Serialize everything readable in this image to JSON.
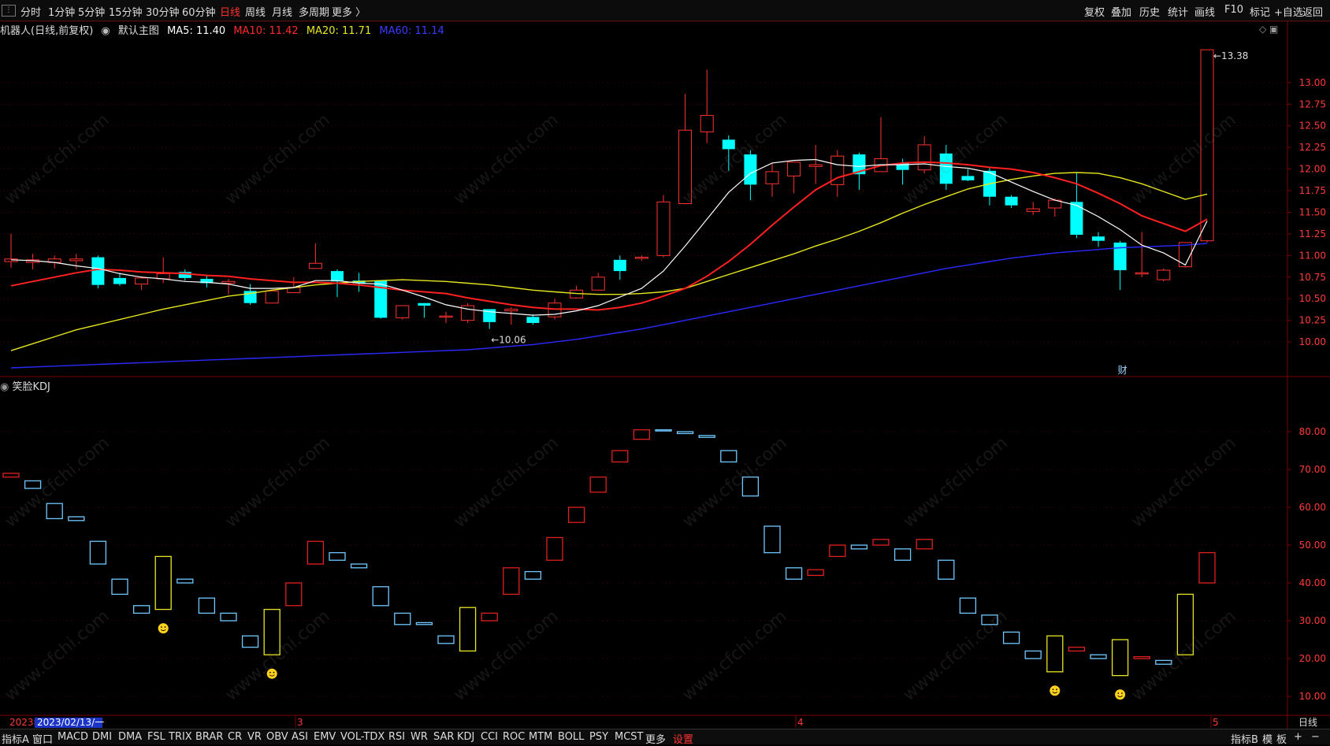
{
  "toolbar": {
    "left": [
      "分时",
      "1分钟",
      "5分钟",
      "15分钟",
      "30分钟",
      "60分钟",
      "日线",
      "周线",
      "月线",
      "多周期",
      "更多 〉"
    ],
    "active": "日线",
    "right": [
      "复权",
      "叠加",
      "历史",
      "统计",
      "画线",
      "F10",
      "标记",
      "+自选",
      "返回"
    ]
  },
  "main_info": {
    "name": "机器人(日线,前复权)",
    "chart_name": "默认主图",
    "ma5": "MA5: 11.40",
    "ma10": "MA10: 11.42",
    "ma20": "MA20: 11.71",
    "ma60": "MA60: 11.14"
  },
  "kdj_info": {
    "name": "笑脸KDJ"
  },
  "colors": {
    "up": "#ff3232",
    "down": "#00ffff",
    "ma5": "#ffffff",
    "ma10": "#ff2020",
    "ma20": "#e6e61e",
    "ma60": "#2a2aff",
    "kdj_up": "#e02020",
    "kdj_down": "#6fc8ff",
    "kdj_flag": "#e6e620",
    "grid": "#7a0000"
  },
  "annotations": {
    "low_label": "10.06",
    "high_label": "13.38",
    "fin_mark": "财"
  },
  "x_axis": {
    "date_box": "2023/02/13/一",
    "year_tag": "2023年",
    "month_marks": [
      "3",
      "4",
      "5"
    ],
    "period": "日线"
  },
  "bottom_tabs": [
    "指标A",
    "窗口",
    "MACD",
    "DMI",
    "DMA",
    "FSL",
    "TRIX",
    "BRAR",
    "CR",
    "VR",
    "OBV",
    "ASI",
    "EMV",
    "VOL-TDX",
    "RSI",
    "WR",
    "SAR",
    "KDJ",
    "CCI",
    "ROC",
    "MTM",
    "BOLL",
    "PSY",
    "MCST",
    "更多",
    "设置"
  ],
  "bottom_right": [
    "指标B",
    "模",
    "板",
    "+",
    "−"
  ],
  "watermark": "www.cfchi.com",
  "chart_data": [
    {
      "type": "candlestick",
      "title": "机器人(日线,前复权)",
      "ylim": [
        9.6,
        13.5
      ],
      "y_ticks": [
        10.0,
        10.25,
        10.5,
        10.75,
        11.0,
        11.25,
        11.5,
        11.75,
        12.0,
        12.25,
        12.5,
        12.75,
        13.0
      ],
      "candles": [
        {
          "o": 10.93,
          "h": 11.25,
          "l": 10.86,
          "c": 10.96
        },
        {
          "o": 10.92,
          "h": 11.02,
          "l": 10.84,
          "c": 10.95
        },
        {
          "o": 10.92,
          "h": 11.0,
          "l": 10.85,
          "c": 10.96
        },
        {
          "o": 10.94,
          "h": 11.02,
          "l": 10.84,
          "c": 10.96
        },
        {
          "o": 10.98,
          "h": 11.0,
          "l": 10.62,
          "c": 10.66
        },
        {
          "o": 10.74,
          "h": 10.8,
          "l": 10.65,
          "c": 10.67
        },
        {
          "o": 10.67,
          "h": 10.76,
          "l": 10.6,
          "c": 10.74
        },
        {
          "o": 10.73,
          "h": 10.98,
          "l": 10.68,
          "c": 10.79
        },
        {
          "o": 10.81,
          "h": 10.84,
          "l": 10.71,
          "c": 10.74
        },
        {
          "o": 10.73,
          "h": 10.78,
          "l": 10.63,
          "c": 10.68
        },
        {
          "o": 10.68,
          "h": 10.73,
          "l": 10.55,
          "c": 10.7
        },
        {
          "o": 10.59,
          "h": 10.67,
          "l": 10.43,
          "c": 10.45
        },
        {
          "o": 10.45,
          "h": 10.6,
          "l": 10.45,
          "c": 10.59
        },
        {
          "o": 10.57,
          "h": 10.75,
          "l": 10.57,
          "c": 10.63
        },
        {
          "o": 10.85,
          "h": 11.14,
          "l": 10.85,
          "c": 10.91
        },
        {
          "o": 10.82,
          "h": 10.84,
          "l": 10.52,
          "c": 10.7
        },
        {
          "o": 10.71,
          "h": 10.8,
          "l": 10.58,
          "c": 10.68
        },
        {
          "o": 10.71,
          "h": 10.71,
          "l": 10.27,
          "c": 10.28
        },
        {
          "o": 10.28,
          "h": 10.42,
          "l": 10.26,
          "c": 10.42
        },
        {
          "o": 10.45,
          "h": 10.45,
          "l": 10.28,
          "c": 10.42
        },
        {
          "o": 10.3,
          "h": 10.35,
          "l": 10.22,
          "c": 10.3
        },
        {
          "o": 10.25,
          "h": 10.45,
          "l": 10.22,
          "c": 10.42
        },
        {
          "o": 10.38,
          "h": 10.38,
          "l": 10.15,
          "c": 10.23
        },
        {
          "o": 10.36,
          "h": 10.4,
          "l": 10.2,
          "c": 10.38
        },
        {
          "o": 10.29,
          "h": 10.32,
          "l": 10.2,
          "c": 10.22
        },
        {
          "o": 10.29,
          "h": 10.5,
          "l": 10.26,
          "c": 10.45
        },
        {
          "o": 10.51,
          "h": 10.65,
          "l": 10.5,
          "c": 10.6
        },
        {
          "o": 10.6,
          "h": 10.8,
          "l": 10.6,
          "c": 10.75
        },
        {
          "o": 10.95,
          "h": 11.0,
          "l": 10.72,
          "c": 10.82
        },
        {
          "o": 10.97,
          "h": 11.0,
          "l": 10.94,
          "c": 10.98
        },
        {
          "o": 11.0,
          "h": 11.7,
          "l": 10.98,
          "c": 11.62
        },
        {
          "o": 11.6,
          "h": 12.87,
          "l": 11.62,
          "c": 12.45
        },
        {
          "o": 12.43,
          "h": 13.15,
          "l": 12.3,
          "c": 12.62
        },
        {
          "o": 12.34,
          "h": 12.39,
          "l": 11.98,
          "c": 12.23
        },
        {
          "o": 12.17,
          "h": 12.22,
          "l": 11.64,
          "c": 11.82
        },
        {
          "o": 11.83,
          "h": 12.07,
          "l": 11.68,
          "c": 11.97
        },
        {
          "o": 11.92,
          "h": 12.07,
          "l": 11.72,
          "c": 12.08
        },
        {
          "o": 12.03,
          "h": 12.28,
          "l": 11.83,
          "c": 12.05
        },
        {
          "o": 11.82,
          "h": 12.22,
          "l": 11.68,
          "c": 12.15
        },
        {
          "o": 12.17,
          "h": 12.19,
          "l": 11.76,
          "c": 11.94
        },
        {
          "o": 11.97,
          "h": 12.6,
          "l": 11.97,
          "c": 12.12
        },
        {
          "o": 12.07,
          "h": 12.12,
          "l": 11.82,
          "c": 11.99
        },
        {
          "o": 11.99,
          "h": 12.38,
          "l": 11.95,
          "c": 12.28
        },
        {
          "o": 12.18,
          "h": 12.28,
          "l": 11.76,
          "c": 11.83
        },
        {
          "o": 11.92,
          "h": 12.0,
          "l": 11.86,
          "c": 11.87
        },
        {
          "o": 11.98,
          "h": 12.02,
          "l": 11.58,
          "c": 11.68
        },
        {
          "o": 11.68,
          "h": 11.7,
          "l": 11.55,
          "c": 11.58
        },
        {
          "o": 11.51,
          "h": 11.62,
          "l": 11.47,
          "c": 11.54
        },
        {
          "o": 11.55,
          "h": 11.66,
          "l": 11.45,
          "c": 11.64
        },
        {
          "o": 11.62,
          "h": 11.95,
          "l": 11.2,
          "c": 11.24
        },
        {
          "o": 11.22,
          "h": 11.27,
          "l": 11.1,
          "c": 11.17
        },
        {
          "o": 11.15,
          "h": 11.17,
          "l": 10.6,
          "c": 10.83
        },
        {
          "o": 10.8,
          "h": 11.27,
          "l": 10.75,
          "c": 10.8
        },
        {
          "o": 10.72,
          "h": 10.85,
          "l": 10.7,
          "c": 10.83
        },
        {
          "o": 10.87,
          "h": 11.15,
          "l": 10.86,
          "c": 11.15
        },
        {
          "o": 11.17,
          "h": 13.38,
          "l": 11.15,
          "c": 13.38
        }
      ],
      "ma5": [
        10.95,
        10.94,
        10.92,
        10.88,
        10.85,
        10.79,
        10.75,
        10.73,
        10.7,
        10.69,
        10.67,
        10.62,
        10.62,
        10.63,
        10.71,
        10.71,
        10.68,
        10.67,
        10.6,
        10.52,
        10.43,
        10.38,
        10.35,
        10.33,
        10.31,
        10.32,
        10.36,
        10.42,
        10.52,
        10.62,
        10.82,
        11.11,
        11.42,
        11.73,
        11.95,
        12.07,
        12.1,
        12.11,
        12.05,
        12.03,
        12.05,
        12.05,
        12.06,
        12.03,
        12.01,
        11.96,
        11.85,
        11.74,
        11.64,
        11.58,
        11.45,
        11.3,
        11.12,
        11.03,
        10.89,
        11.4
      ],
      "ma10": [
        10.65,
        10.7,
        10.75,
        10.8,
        10.84,
        10.83,
        10.81,
        10.8,
        10.79,
        10.77,
        10.76,
        10.73,
        10.71,
        10.69,
        10.69,
        10.68,
        10.66,
        10.63,
        10.6,
        10.58,
        10.56,
        10.51,
        10.47,
        10.43,
        10.4,
        10.38,
        10.38,
        10.37,
        10.4,
        10.45,
        10.53,
        10.62,
        10.76,
        10.93,
        11.13,
        11.35,
        11.56,
        11.76,
        11.9,
        11.97,
        12.04,
        12.07,
        12.08,
        12.07,
        12.05,
        12.02,
        12.0,
        11.96,
        11.9,
        11.83,
        11.72,
        11.6,
        11.46,
        11.37,
        11.28,
        11.42
      ],
      "ma20": [
        9.9,
        9.98,
        10.06,
        10.14,
        10.2,
        10.26,
        10.32,
        10.38,
        10.43,
        10.48,
        10.53,
        10.56,
        10.6,
        10.63,
        10.66,
        10.68,
        10.7,
        10.71,
        10.72,
        10.71,
        10.7,
        10.68,
        10.66,
        10.63,
        10.6,
        10.58,
        10.56,
        10.55,
        10.55,
        10.56,
        10.58,
        10.62,
        10.7,
        10.78,
        10.86,
        10.94,
        11.02,
        11.11,
        11.19,
        11.28,
        11.38,
        11.49,
        11.59,
        11.68,
        11.77,
        11.83,
        11.88,
        11.92,
        11.95,
        11.96,
        11.95,
        11.9,
        11.83,
        11.74,
        11.65,
        11.71
      ],
      "ma60": [
        9.7,
        9.71,
        9.72,
        9.73,
        9.74,
        9.75,
        9.76,
        9.77,
        9.78,
        9.79,
        9.8,
        9.81,
        9.82,
        9.83,
        9.84,
        9.85,
        9.86,
        9.87,
        9.88,
        9.89,
        9.9,
        9.91,
        9.93,
        9.95,
        9.97,
        10.0,
        10.03,
        10.07,
        10.11,
        10.15,
        10.2,
        10.25,
        10.3,
        10.35,
        10.4,
        10.45,
        10.5,
        10.55,
        10.6,
        10.65,
        10.7,
        10.75,
        10.8,
        10.85,
        10.89,
        10.93,
        10.97,
        11.0,
        11.03,
        11.05,
        11.07,
        11.09,
        11.1,
        11.11,
        11.12,
        11.14
      ]
    },
    {
      "type": "floating-bar",
      "title": "笑脸KDJ",
      "ylim": [
        5,
        90
      ],
      "y_ticks": [
        10,
        20,
        30,
        40,
        50,
        60,
        70,
        80
      ],
      "bars": [
        {
          "lo": 68,
          "hi": 69,
          "c": "up"
        },
        {
          "lo": 65,
          "hi": 67,
          "c": "down"
        },
        {
          "lo": 57,
          "hi": 61,
          "c": "down"
        },
        {
          "lo": 56.5,
          "hi": 57.5,
          "c": "down"
        },
        {
          "lo": 45,
          "hi": 51,
          "c": "down"
        },
        {
          "lo": 37,
          "hi": 41,
          "c": "down"
        },
        {
          "lo": 32,
          "hi": 34,
          "c": "down"
        },
        {
          "lo": 33,
          "hi": 47,
          "c": "flag",
          "smile": true
        },
        {
          "lo": 40,
          "hi": 41,
          "c": "down"
        },
        {
          "lo": 32,
          "hi": 36,
          "c": "down"
        },
        {
          "lo": 30,
          "hi": 32,
          "c": "down"
        },
        {
          "lo": 23,
          "hi": 26,
          "c": "down"
        },
        {
          "lo": 21,
          "hi": 33,
          "c": "flag",
          "smile": true
        },
        {
          "lo": 34,
          "hi": 40,
          "c": "up"
        },
        {
          "lo": 45,
          "hi": 51,
          "c": "up"
        },
        {
          "lo": 46,
          "hi": 48,
          "c": "down"
        },
        {
          "lo": 44,
          "hi": 45,
          "c": "down"
        },
        {
          "lo": 34,
          "hi": 39,
          "c": "down"
        },
        {
          "lo": 29,
          "hi": 32,
          "c": "down"
        },
        {
          "lo": 29,
          "hi": 29.5,
          "c": "down"
        },
        {
          "lo": 24,
          "hi": 26,
          "c": "down"
        },
        {
          "lo": 22,
          "hi": 33.5,
          "c": "flag"
        },
        {
          "lo": 30,
          "hi": 32,
          "c": "up"
        },
        {
          "lo": 37,
          "hi": 44,
          "c": "up"
        },
        {
          "lo": 41,
          "hi": 43,
          "c": "down"
        },
        {
          "lo": 46,
          "hi": 52,
          "c": "up"
        },
        {
          "lo": 56,
          "hi": 60,
          "c": "up"
        },
        {
          "lo": 64,
          "hi": 68,
          "c": "up"
        },
        {
          "lo": 72,
          "hi": 75,
          "c": "up"
        },
        {
          "lo": 78,
          "hi": 80.5,
          "c": "up"
        },
        {
          "lo": 80.3,
          "hi": 80.5,
          "c": "down"
        },
        {
          "lo": 79.5,
          "hi": 80,
          "c": "down"
        },
        {
          "lo": 78.5,
          "hi": 79,
          "c": "down"
        },
        {
          "lo": 72,
          "hi": 75,
          "c": "down"
        },
        {
          "lo": 63,
          "hi": 68,
          "c": "down"
        },
        {
          "lo": 48,
          "hi": 55,
          "c": "down"
        },
        {
          "lo": 41,
          "hi": 44,
          "c": "down"
        },
        {
          "lo": 42,
          "hi": 43.5,
          "c": "up"
        },
        {
          "lo": 47,
          "hi": 50,
          "c": "up"
        },
        {
          "lo": 49,
          "hi": 50,
          "c": "down"
        },
        {
          "lo": 50,
          "hi": 51.5,
          "c": "up"
        },
        {
          "lo": 46,
          "hi": 49,
          "c": "down"
        },
        {
          "lo": 49,
          "hi": 51.5,
          "c": "up"
        },
        {
          "lo": 41,
          "hi": 46,
          "c": "down"
        },
        {
          "lo": 32,
          "hi": 36,
          "c": "down"
        },
        {
          "lo": 29,
          "hi": 31.5,
          "c": "down"
        },
        {
          "lo": 24,
          "hi": 27,
          "c": "down"
        },
        {
          "lo": 20,
          "hi": 22,
          "c": "down"
        },
        {
          "lo": 16.5,
          "hi": 26,
          "c": "flag",
          "smile": true
        },
        {
          "lo": 22,
          "hi": 23,
          "c": "up"
        },
        {
          "lo": 20,
          "hi": 21,
          "c": "down"
        },
        {
          "lo": 15.5,
          "hi": 25,
          "c": "flag",
          "smile": true
        },
        {
          "lo": 20,
          "hi": 20.5,
          "c": "up"
        },
        {
          "lo": 18.5,
          "hi": 19.5,
          "c": "down"
        },
        {
          "lo": 21,
          "hi": 37,
          "c": "flag"
        },
        {
          "lo": 40,
          "hi": 48,
          "c": "up"
        }
      ]
    }
  ]
}
